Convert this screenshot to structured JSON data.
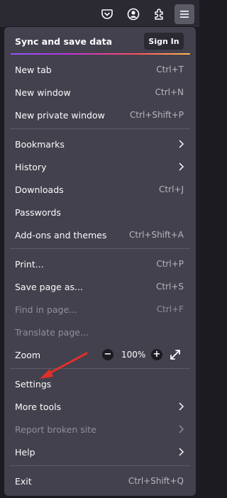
{
  "toolbar": {
    "icons": [
      "pocket-icon",
      "account-icon",
      "extensions-icon",
      "menu-icon"
    ]
  },
  "menu": {
    "sync": {
      "label": "Sync and save data",
      "signin_label": "Sign In"
    },
    "new_tab": {
      "label": "New tab",
      "shortcut": "Ctrl+T"
    },
    "new_window": {
      "label": "New window",
      "shortcut": "Ctrl+N"
    },
    "new_private_window": {
      "label": "New private window",
      "shortcut": "Ctrl+Shift+P"
    },
    "bookmarks": {
      "label": "Bookmarks"
    },
    "history": {
      "label": "History"
    },
    "downloads": {
      "label": "Downloads",
      "shortcut": "Ctrl+J"
    },
    "passwords": {
      "label": "Passwords"
    },
    "addons": {
      "label": "Add-ons and themes",
      "shortcut": "Ctrl+Shift+A"
    },
    "print": {
      "label": "Print...",
      "shortcut": "Ctrl+P"
    },
    "save_page": {
      "label": "Save page as...",
      "shortcut": "Ctrl+S"
    },
    "find_in_page": {
      "label": "Find in page...",
      "shortcut": "Ctrl+F"
    },
    "translate_page": {
      "label": "Translate page..."
    },
    "zoom": {
      "label": "Zoom",
      "value": "100%",
      "minus": "−",
      "plus": "+"
    },
    "settings": {
      "label": "Settings"
    },
    "more_tools": {
      "label": "More tools"
    },
    "report_broken_site": {
      "label": "Report broken site"
    },
    "help": {
      "label": "Help"
    },
    "exit": {
      "label": "Exit",
      "shortcut": "Ctrl+Shift+Q"
    }
  },
  "colors": {
    "accent_gradient": [
      "#9059ff",
      "#ff4f5e",
      "#ffbd4f"
    ],
    "annotation_arrow": "#e0302a"
  }
}
